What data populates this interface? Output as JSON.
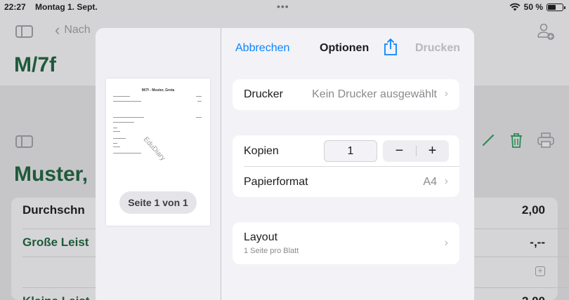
{
  "status": {
    "time": "22:27",
    "date": "Montag 1. Sept.",
    "battery": "50 %",
    "battery_level": 0.5
  },
  "background": {
    "back_label": "Nach",
    "class_title": "M/7f",
    "student_title": "Muster,",
    "rows": [
      {
        "label": "Durchschn",
        "value": "2,00"
      },
      {
        "label": "Große Leist",
        "value": "-,--"
      },
      {
        "label": "Kleine Leist",
        "value": "2,00"
      }
    ],
    "accent_color": "#1f5a3a"
  },
  "preview": {
    "page_title": "M/7f - Muster, Greta",
    "watermark": "EduDiary",
    "page_label": "Seite 1 von 1"
  },
  "nav": {
    "cancel": "Abbrechen",
    "title": "Optionen",
    "print": "Drucken"
  },
  "printer": {
    "label": "Drucker",
    "value": "Kein Drucker ausgewählt"
  },
  "copies": {
    "label": "Kopien",
    "value": "1",
    "minus": "−",
    "plus": "+"
  },
  "paper": {
    "label": "Papierformat",
    "value": "A4"
  },
  "layout": {
    "label": "Layout",
    "sub": "1 Seite pro Blatt"
  },
  "icons": {
    "chevron": "›",
    "share": "share-icon",
    "trash": "trash-icon",
    "pencil": "pencil-icon",
    "printer": "printer-icon"
  },
  "colors": {
    "link": "#0a84ff",
    "disabled": "#b7b7bc"
  }
}
